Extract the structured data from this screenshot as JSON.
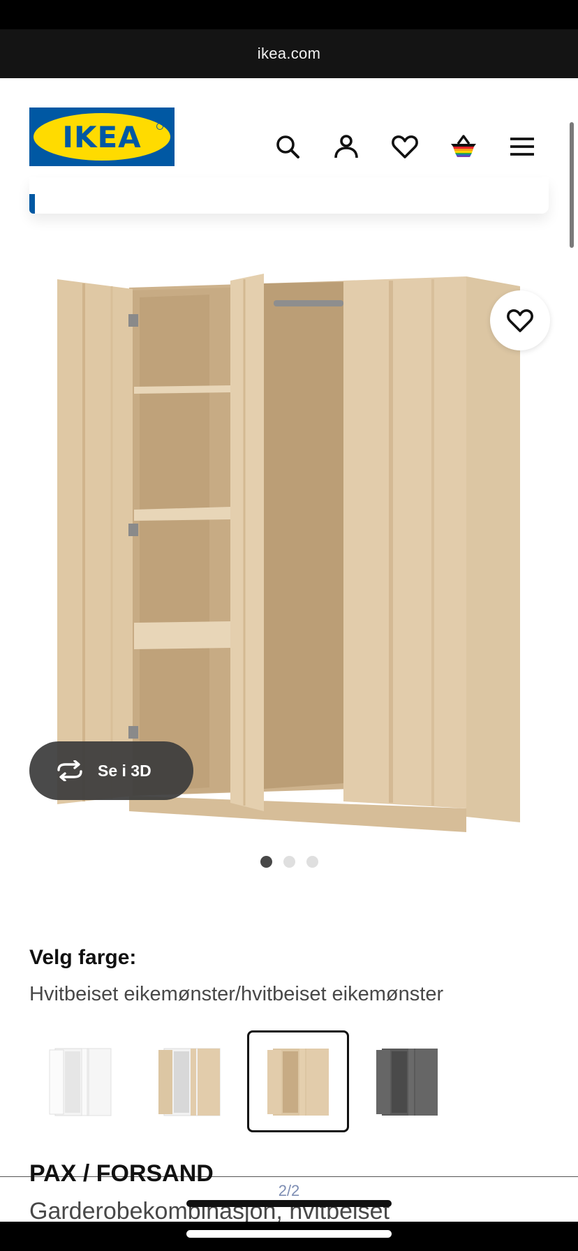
{
  "browser": {
    "url": "ikea.com"
  },
  "header": {
    "logo_text": "IKEA",
    "icons": [
      "search-icon",
      "account-icon",
      "heart-icon",
      "basket-icon",
      "menu-icon"
    ]
  },
  "gallery": {
    "view_3d_label": "Se i 3D",
    "image_count": 3,
    "active_image": 1
  },
  "color": {
    "title": "Velg farge:",
    "selected": "Hvitbeiset eikemønster/hvitbeiset eikemønster",
    "options": [
      "white",
      "white-oak-grey",
      "white-stained-oak",
      "dark-grey"
    ],
    "selected_index": 2
  },
  "product": {
    "name": "PAX / FORSAND",
    "description": "Garderobekombinasjon, hvitbeiset"
  },
  "pager": {
    "text": "2/2"
  },
  "colors": {
    "ikea_blue": "#0058a3",
    "ikea_yellow": "#ffdb00",
    "oak_light": "#e2ccab",
    "oak_mid": "#d4b994"
  }
}
